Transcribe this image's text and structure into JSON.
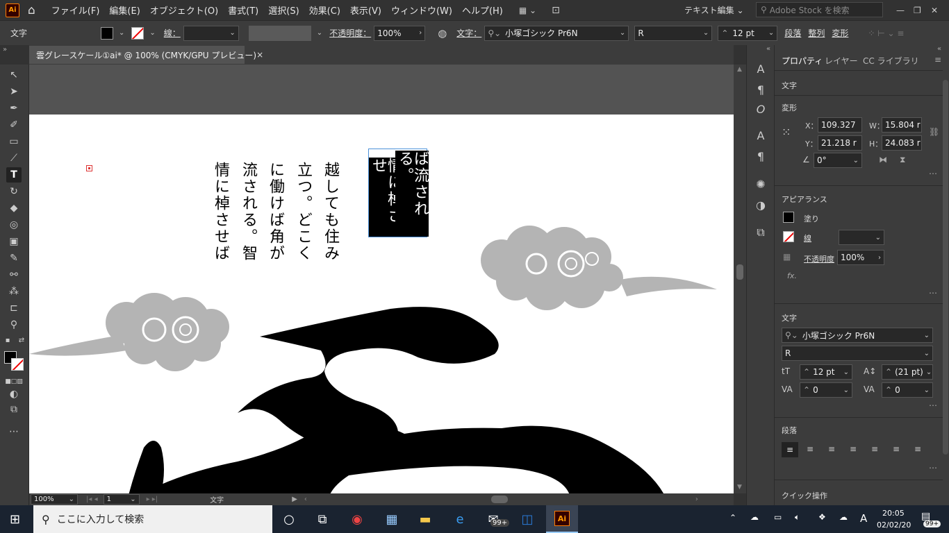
{
  "app": {
    "logo": "Ai"
  },
  "menu": [
    "ファイル(F)",
    "編集(E)",
    "オブジェクト(O)",
    "書式(T)",
    "選択(S)",
    "効果(C)",
    "表示(V)",
    "ウィンドウ(W)",
    "ヘルプ(H)"
  ],
  "workspace": "テキスト編集",
  "stock_search": {
    "placeholder": "Adobe Stock を検索"
  },
  "control": {
    "mode": "文字",
    "stroke_label": "線：",
    "opacity_label": "不透明度：",
    "opacity": "100%",
    "char_label": "文字：",
    "font": "小塚ゴシック Pr6N",
    "style": "R",
    "size": "12 pt",
    "paragraph": "段落",
    "align": "整列",
    "transform": "変形"
  },
  "document_tab": {
    "title": "雲グレースケール①ai* @ 100% (CMYK/GPU プレビュー)",
    "close": "×"
  },
  "artboard_text": {
    "columns": [
      "情に棹させば",
      "流される。智",
      "に働けば角が",
      "立つ。どこく",
      "越しても住み"
    ],
    "selected": [
      "情に棹させ",
      "ば流される。"
    ]
  },
  "status": {
    "zoom": "100%",
    "page": "1",
    "tool": "文字"
  },
  "panel": {
    "tabs": [
      "プロパティ",
      "レイヤー",
      "CC ライブラリ"
    ],
    "section_type": "文字",
    "transform": {
      "title": "変形",
      "x_label": "X：",
      "x": "109.327",
      "y_label": "Y：",
      "y": "21.218 r",
      "w_label": "W：",
      "w": "15.804 r",
      "h_label": "H：",
      "h": "24.083 r",
      "angle": "0°"
    },
    "appearance": {
      "title": "アピアランス",
      "fill": "塗り",
      "stroke": "線",
      "opacity_label": "不透明度",
      "opacity": "100%",
      "fx": "fx."
    },
    "character": {
      "title": "文字",
      "font": "小塚ゴシック Pr6N",
      "style": "R",
      "size": "12 pt",
      "leading": "(21 pt)",
      "tracking": "0",
      "kerning": "0"
    },
    "paragraph": {
      "title": "段落"
    },
    "quick_actions": {
      "title": "クイック操作"
    }
  },
  "taskbar": {
    "search_placeholder": "ここに入力して検索",
    "time": "20:05",
    "date": "02/02/20",
    "mail_badge": "99+",
    "notif_badge": "99+",
    "ime": "A"
  },
  "colors": {
    "cloud": "#b4b4b4",
    "accent": "#ff9a00",
    "selection": "#4a90d9"
  }
}
